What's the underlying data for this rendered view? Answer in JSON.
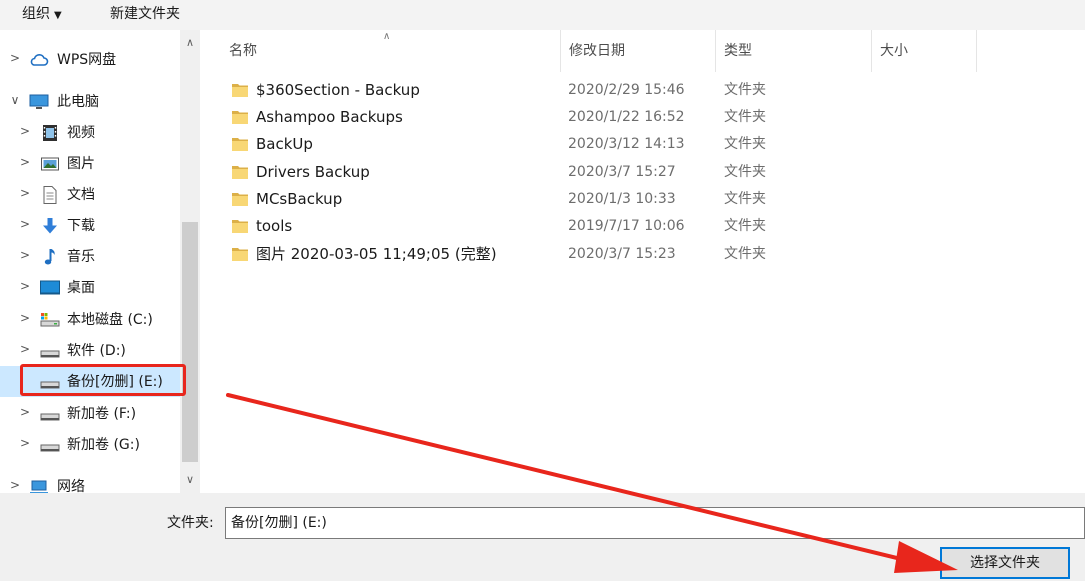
{
  "toolbar": {
    "organize": "组织",
    "new_folder": "新建文件夹"
  },
  "nav": {
    "items": [
      {
        "label": "WPS网盘",
        "icon": "cloud-icon"
      },
      {
        "label": "此电脑",
        "icon": "computer-icon"
      },
      {
        "label": "视频",
        "icon": "video-icon"
      },
      {
        "label": "图片",
        "icon": "pictures-icon"
      },
      {
        "label": "文档",
        "icon": "documents-icon"
      },
      {
        "label": "下载",
        "icon": "download-icon"
      },
      {
        "label": "音乐",
        "icon": "music-icon"
      },
      {
        "label": "桌面",
        "icon": "desktop-icon"
      },
      {
        "label": "本地磁盘 (C:)",
        "icon": "system-drive-icon"
      },
      {
        "label": "软件 (D:)",
        "icon": "drive-icon"
      },
      {
        "label": "备份[勿删] (E:)",
        "icon": "drive-icon"
      },
      {
        "label": "新加卷 (F:)",
        "icon": "drive-icon"
      },
      {
        "label": "新加卷 (G:)",
        "icon": "drive-icon"
      },
      {
        "label": "网络",
        "icon": "network-icon"
      }
    ]
  },
  "columns": {
    "name": "名称",
    "date": "修改日期",
    "type": "类型",
    "size": "大小"
  },
  "files": [
    {
      "name": "$360Section - Backup",
      "date": "2020/2/29 15:46",
      "type": "文件夹"
    },
    {
      "name": "Ashampoo Backups",
      "date": "2020/1/22 16:52",
      "type": "文件夹"
    },
    {
      "name": "BackUp",
      "date": "2020/3/12 14:13",
      "type": "文件夹"
    },
    {
      "name": "Drivers Backup",
      "date": "2020/3/7 15:27",
      "type": "文件夹"
    },
    {
      "name": "MCsBackup",
      "date": "2020/1/3 10:33",
      "type": "文件夹"
    },
    {
      "name": "tools",
      "date": "2019/7/17 10:06",
      "type": "文件夹"
    },
    {
      "name": "图片 2020-03-05 11;49;05 (完整)",
      "date": "2020/3/7 15:23",
      "type": "文件夹"
    }
  ],
  "bottom": {
    "folder_label": "文件夹:",
    "folder_value": "备份[勿删] (E:)",
    "select_button": "选择文件夹"
  },
  "colors": {
    "selection": "#cce8ff",
    "accent": "#0078d7",
    "annotation": "#e8261c",
    "folder": "#f8d775"
  }
}
